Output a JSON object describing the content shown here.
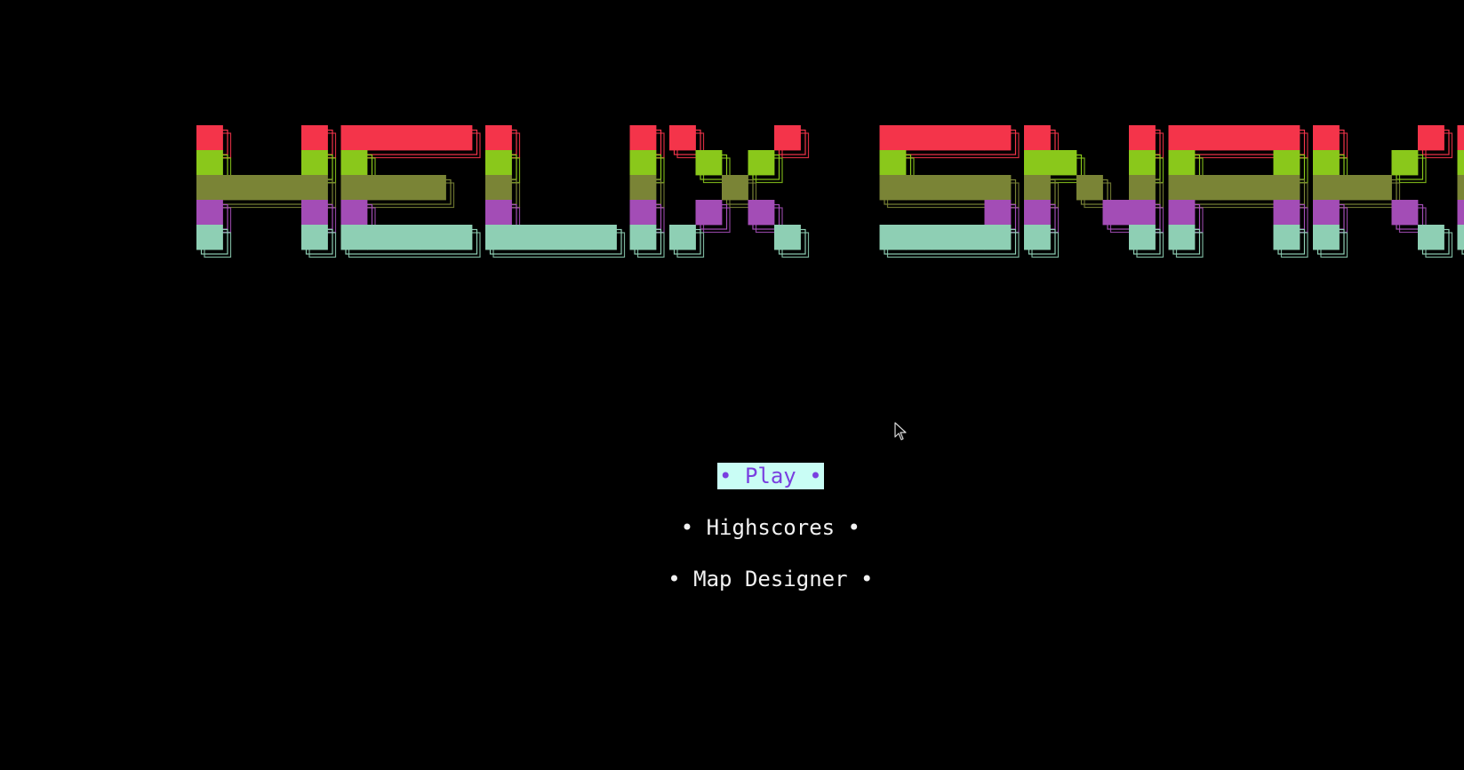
{
  "game": {
    "title": "HELIX SNAKE",
    "colors": {
      "background": "#000000",
      "stripe_1": "#f4344a",
      "stripe_2": "#8ac81b",
      "stripe_3": "#7a8436",
      "stripe_4": "#a34db6",
      "stripe_5": "#8ecfb4",
      "menu_text": "#f2f2f2",
      "selected_bg": "#c9fdf5",
      "selected_text": "#7a3fe0"
    }
  },
  "menu": {
    "items": [
      {
        "label": "• Play •",
        "selected": true
      },
      {
        "label": "• Highscores •",
        "selected": false
      },
      {
        "label": "• Map Designer •",
        "selected": false
      }
    ]
  },
  "pointer": {
    "icon": "mouse-pointer-icon"
  }
}
